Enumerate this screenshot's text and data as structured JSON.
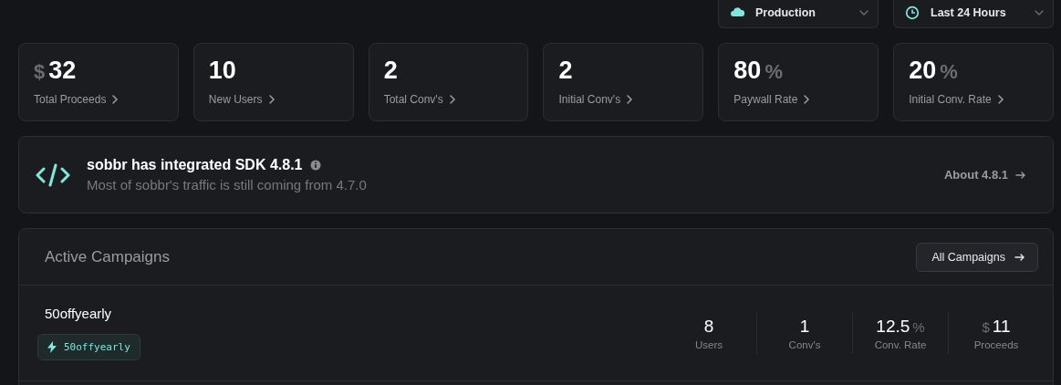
{
  "filters": [
    {
      "kind": "environment",
      "label": "Production"
    },
    {
      "kind": "time",
      "label": "Last 24 Hours"
    }
  ],
  "stats": [
    {
      "prefix": "$",
      "value": "32",
      "label": "Total Proceeds"
    },
    {
      "value": "10",
      "label": "New Users"
    },
    {
      "value": "2",
      "label": "Total Conv's"
    },
    {
      "value": "2",
      "label": "Initial Conv's"
    },
    {
      "value": "80",
      "suffix": "%",
      "label": "Paywall Rate"
    },
    {
      "value": "20",
      "suffix": "%",
      "label": "Initial Conv. Rate"
    }
  ],
  "sdk_banner": {
    "title": "sobbr has integrated SDK 4.8.1",
    "subtitle": "Most of sobbr's traffic is still coming from 4.7.0",
    "link": "About 4.8.1"
  },
  "campaigns": {
    "title": "Active Campaigns",
    "button": "All Campaigns",
    "rows": [
      {
        "name": "50offyearly",
        "tag": "50offyearly",
        "metrics": [
          {
            "value": "8",
            "label": "Users"
          },
          {
            "value": "1",
            "label": "Conv's"
          },
          {
            "value": "12.5",
            "suffix": "%",
            "label": "Conv. Rate"
          },
          {
            "prefix": "$",
            "value": "11",
            "label": "Proceeds"
          }
        ]
      }
    ]
  }
}
